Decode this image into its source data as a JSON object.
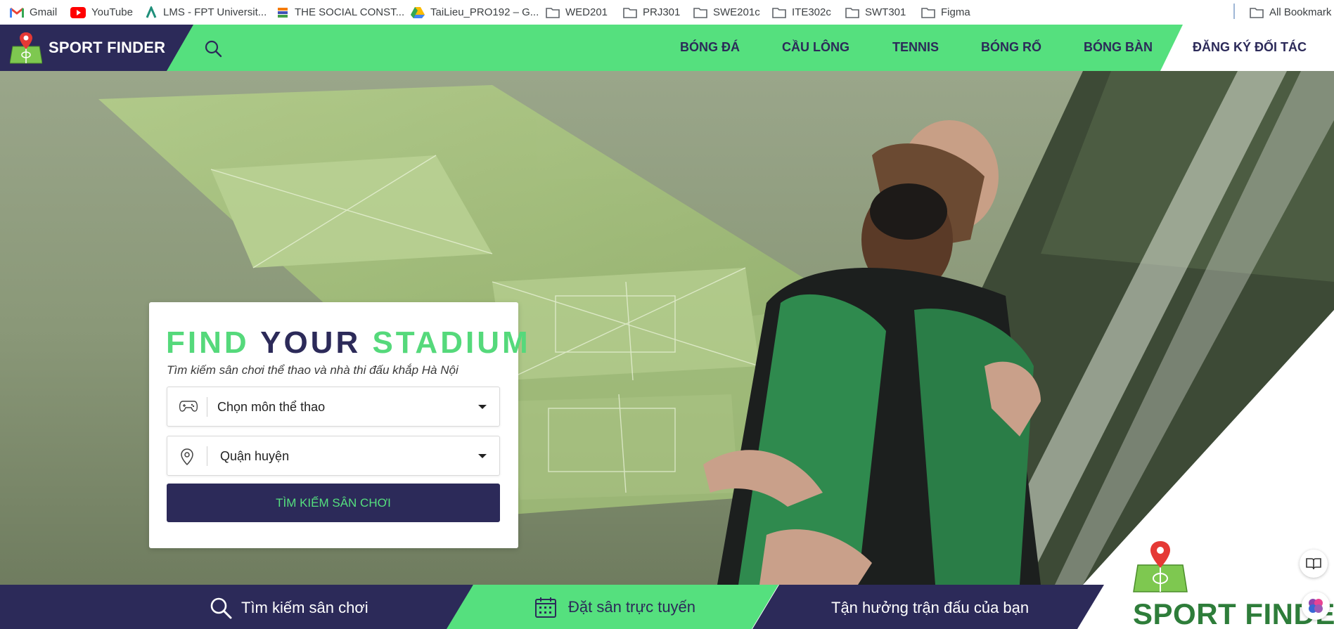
{
  "bookmarks": [
    {
      "label": "Gmail",
      "icon": "gmail-icon"
    },
    {
      "label": "YouTube",
      "icon": "youtube-icon"
    },
    {
      "label": "LMS - FPT Universit...",
      "icon": "lms-icon"
    },
    {
      "label": "THE SOCIAL CONST...",
      "icon": "stack-icon"
    },
    {
      "label": "TaiLieu_PRO192 – G...",
      "icon": "drive-icon"
    },
    {
      "label": "WED201",
      "icon": "folder-icon"
    },
    {
      "label": "PRJ301",
      "icon": "folder-icon"
    },
    {
      "label": "SWE201c",
      "icon": "folder-icon"
    },
    {
      "label": "ITE302c",
      "icon": "folder-icon"
    },
    {
      "label": "SWT301",
      "icon": "folder-icon"
    },
    {
      "label": "Figma",
      "icon": "folder-icon"
    },
    {
      "label": "All Bookmark",
      "icon": "folder-icon"
    }
  ],
  "nav": {
    "brand": "SPORT FINDER",
    "links": [
      "BÓNG ĐÁ",
      "CẦU LÔNG",
      "TENNIS",
      "BÓNG RỔ",
      "BÓNG BÀN"
    ],
    "partner": "ĐĂNG KÝ ĐỐI TÁC"
  },
  "search_card": {
    "title_1": "FIND",
    "title_2": "YOUR",
    "title_3": "STADIUM",
    "subtitle": "Tìm kiếm sân chơi thể thao và nhà thi đấu khắp Hà Nội",
    "sport_select": "Chọn môn thể thao",
    "district_select": "Quận huyện",
    "button": "TÌM KIẾM SÂN CHƠI"
  },
  "features": {
    "search": "Tìm kiếm sân chơi",
    "book": "Đặt sân trực tuyến",
    "enjoy": "Tận hưởng trận đấu của bạn"
  },
  "brand_corner": "SPORT FINDER",
  "colors": {
    "navy": "#2c2a59",
    "green": "#55e07e"
  }
}
